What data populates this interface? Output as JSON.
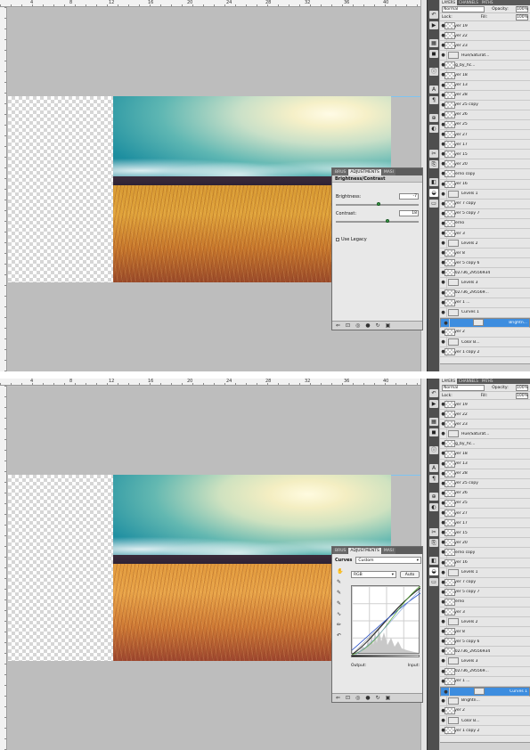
{
  "screens": [
    {
      "panel_tabs": [
        "BRUS",
        "ADJUSTMENTS",
        "MASI"
      ],
      "panel_title": "Brightness/Contrast",
      "brightness_label": "Brightness:",
      "brightness_value": "-7",
      "contrast_label": "Contrast:",
      "contrast_value": "18",
      "legacy_label": "Use Legacy"
    },
    {
      "panel_tabs": [
        "BRUS",
        "ADJUSTMENTS",
        "MASI"
      ],
      "curves_label": "Curves",
      "preset_value": "Custom",
      "channel_value": "RGB",
      "auto_label": "Auto",
      "output_label": "Output:",
      "input_label": "Input:"
    }
  ],
  "layers_panel": {
    "tabs": [
      "LAYERS",
      "CHANNELS",
      "PATHS"
    ],
    "blend_mode": "Normal",
    "opacity_label": "Opacity:",
    "opacity_value": "100%",
    "lock_label": "Lock:",
    "fill_label": "Fill:",
    "fill_value": "100%",
    "layers": [
      {
        "name": "Layer 19",
        "thumb": "chk"
      },
      {
        "name": "Layer 22",
        "thumb": "chk"
      },
      {
        "name": "Layer 23",
        "thumb": "chk"
      },
      {
        "name": "Hue/Saturat...",
        "thumb": "adj"
      },
      {
        "name": "ring_by_hc...",
        "thumb": "chk"
      },
      {
        "name": "Layer 18",
        "thumb": "chk"
      },
      {
        "name": "Layer 13",
        "thumb": "chk"
      },
      {
        "name": "Layer 28",
        "thumb": "chk"
      },
      {
        "name": "Layer 25 copy",
        "thumb": "chk"
      },
      {
        "name": "Layer 26",
        "thumb": "chk"
      },
      {
        "name": "Layer 25",
        "thumb": "chk"
      },
      {
        "name": "Layer 27",
        "thumb": "chk"
      },
      {
        "name": "Layer 17",
        "thumb": "chk"
      },
      {
        "name": "Layer 15",
        "thumb": "chk"
      },
      {
        "name": "Layer 20",
        "thumb": "chk"
      },
      {
        "name": "Cuerno copy",
        "thumb": "chk"
      },
      {
        "name": "Layer 16",
        "thumb": "chk"
      },
      {
        "name": "Levels 1",
        "thumb": "adj"
      },
      {
        "name": "Layer 7 copy",
        "thumb": "chk"
      },
      {
        "name": "Layer 5 copy 7",
        "thumb": "chk"
      },
      {
        "name": "Cuerno",
        "thumb": "chk"
      },
      {
        "name": "Layer 3",
        "thumb": "chk"
      },
      {
        "name": "Levels 2",
        "thumb": "adj"
      },
      {
        "name": "Layer 8",
        "thumb": "chk"
      },
      {
        "name": "Layer 5 copy 6",
        "thumb": "chk"
      },
      {
        "name": "1402736_29556934",
        "thumb": "chk"
      },
      {
        "name": "Levels 3",
        "thumb": "adj"
      },
      {
        "name": "1402736_295569...",
        "thumb": "chk"
      },
      {
        "name": "Layer 1 ...",
        "thumb": "chk"
      },
      {
        "name": "Curves 1",
        "thumb": "adj"
      },
      {
        "name": "Brightn...",
        "thumb": "adj"
      },
      {
        "name": "Layer 2",
        "thumb": "chk"
      },
      {
        "name": "Color B...",
        "thumb": "adj"
      },
      {
        "name": "Layer 1 copy 2",
        "thumb": "chk"
      }
    ]
  },
  "ruler_numbers": [
    "4",
    "8",
    "12",
    "16",
    "20",
    "24",
    "28",
    "32",
    "36",
    "40"
  ],
  "colors": {
    "selection": "#3d8ddf",
    "chrome_dark": "#4e4e4e",
    "canvas_bg": "#bdbdbd"
  }
}
